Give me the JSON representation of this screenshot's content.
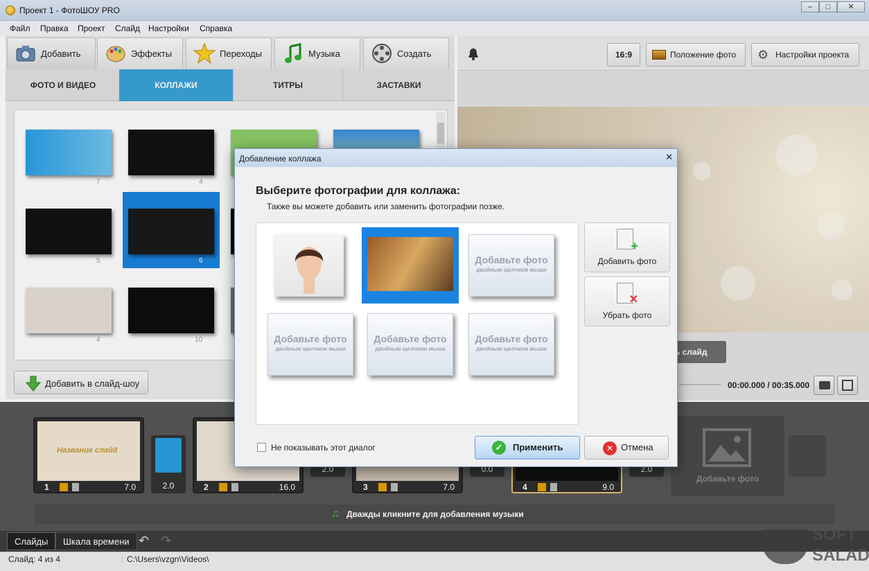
{
  "window": {
    "title": "Проект 1 - ФотоШОУ PRO"
  },
  "menu": [
    "Файл",
    "Правка",
    "Проект",
    "Слайд",
    "Настройки",
    "Справка"
  ],
  "main_tabs": [
    {
      "label": "Добавить",
      "icon": "camera-icon"
    },
    {
      "label": "Эффекты",
      "icon": "palette-icon"
    },
    {
      "label": "Переходы",
      "icon": "star-icon"
    },
    {
      "label": "Музыка",
      "icon": "music-note-icon"
    },
    {
      "label": "Создать",
      "icon": "film-reel-icon"
    }
  ],
  "sub_tabs": [
    "ФОТО И ВИДЕО",
    "КОЛЛАЖИ",
    "ТИТРЫ",
    "ЗАСТАВКИ"
  ],
  "gallery": {
    "counts": [
      "7",
      "4",
      "5",
      "6",
      "4",
      "10"
    ]
  },
  "add_to_slideshow": "Добавить в слайд-шоу",
  "right_toolbar": {
    "ratio": "16:9",
    "photo_position": "Положение фото",
    "project_settings": "Настройки проекта"
  },
  "preview": {
    "partial_button": "ть слайд",
    "time": "00:00.000 / 00:35.000"
  },
  "timeline": {
    "slides": [
      {
        "num": "1",
        "dur": "7.0",
        "caption": "Название слайд"
      },
      {
        "num": "2",
        "dur": "16.0"
      },
      {
        "num": "3",
        "dur": "7.0"
      },
      {
        "num": "4",
        "dur": "9.0"
      }
    ],
    "transitions": [
      "2.0",
      "2.0",
      "0.0",
      "2.0"
    ],
    "add_photo": "Добавьте фото",
    "music_hint": "Дважды кликните для добавления музыки"
  },
  "bottom_tabs": [
    "Слайды",
    "Шкала времени"
  ],
  "status": {
    "slides": "Слайд: 4 из 4",
    "path": "C:\\Users\\vzgn\\Videos\\"
  },
  "dialog": {
    "title": "Добавление коллажа",
    "heading": "Выберите фотографии для коллажа:",
    "subheading": "Также вы можете добавить или заменить фотографии позже.",
    "placeholder_title": "Добавьте фото",
    "placeholder_hint": "двойным щелчком мыши",
    "add_photo": "Добавить фото",
    "remove_photo": "Убрать фото",
    "dont_show": "Не показывать этот диалог",
    "apply": "Применить",
    "cancel": "Отмена"
  },
  "watermark": {
    "line1": "SOFT",
    "line2": "SALAD"
  },
  "colors": {
    "accent": "#3aa3d9",
    "selection": "#1a84e0",
    "timeline": "#575757"
  }
}
